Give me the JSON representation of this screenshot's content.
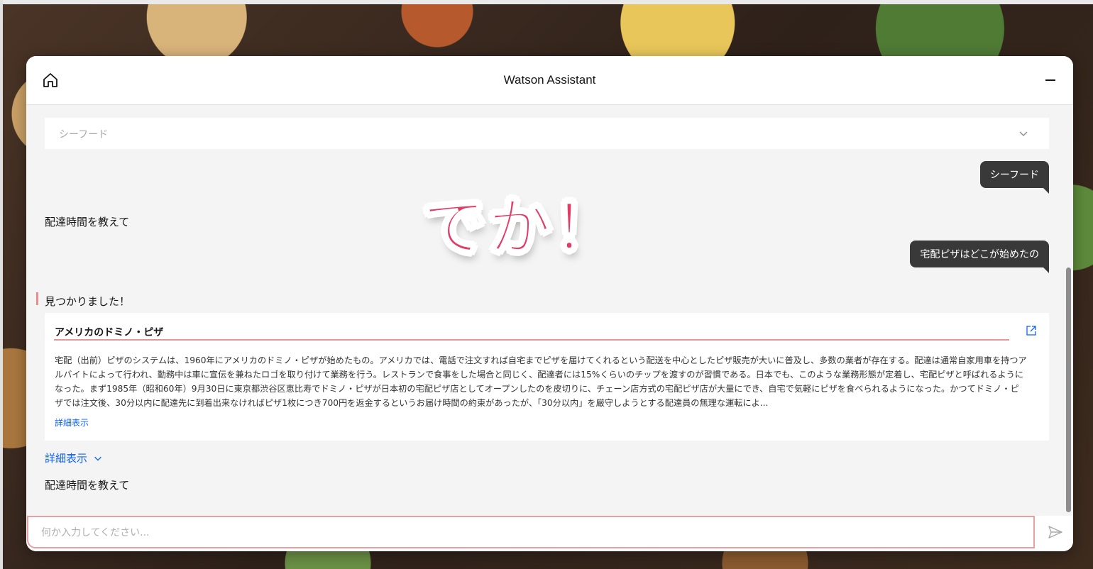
{
  "header": {
    "title": "Watson Assistant",
    "home_icon": "home-icon",
    "minimize_icon": "minimize-icon"
  },
  "dropdown": {
    "selected": "シーフード",
    "icon": "chevron-down-icon"
  },
  "messages": {
    "user_1": "シーフード",
    "bot_1": "配達時間を教えて",
    "user_2": "宅配ピザはどこが始めたの",
    "bot_found": "見つかりました！",
    "bot_2": "配達時間を教えて"
  },
  "search_result": {
    "title": "アメリカのドミノ・ピザ",
    "body": "宅配（出前）ピザのシステムは、1960年にアメリカのドミノ・ピザが始めたもの。アメリカでは、電話で注文すれば自宅までピザを届けてくれるという配送を中心としたピザ販売が大いに普及し、多数の業者が存在する。配達は通常自家用車を持つアルバイトによって行われ、勤務中は車に宣伝を兼ねたロゴを取り付けて業務を行う。レストランで食事をした場合と同じく、配達者には15%くらいのチップを渡すのが習慣である。日本でも、このような業務形態が定着し、宅配ピザと呼ばれるようになった。まず1985年（昭和60年）9月30日に東京都渋谷区恵比寿でドミノ・ピザが日本初の宅配ピザ店としてオープンしたのを皮切りに、チェーン店方式の宅配ピザ店が大量にでき、自宅で気軽にピザを食べられるようになった。かつてドミノ・ピザでは注文後、30分以内に配達先に到着出来なければピザ1枚につき700円を返金するというお届け時間の約束があったが、「30分以内」を厳守しようとする配達員の無理な運転によ...",
    "more_label": "詳細表示",
    "external_icon": "external-link-icon"
  },
  "show_more": {
    "label": "詳細表示",
    "icon": "chevron-down-icon"
  },
  "input": {
    "placeholder": "何か入力してください...",
    "send_icon": "send-icon"
  },
  "overlay": {
    "text": "でか！"
  },
  "colors": {
    "accent_link": "#0f62fe",
    "user_bubble": "#393939",
    "highlight": "#e8a0a0",
    "overlay_text": "#e03c66"
  }
}
